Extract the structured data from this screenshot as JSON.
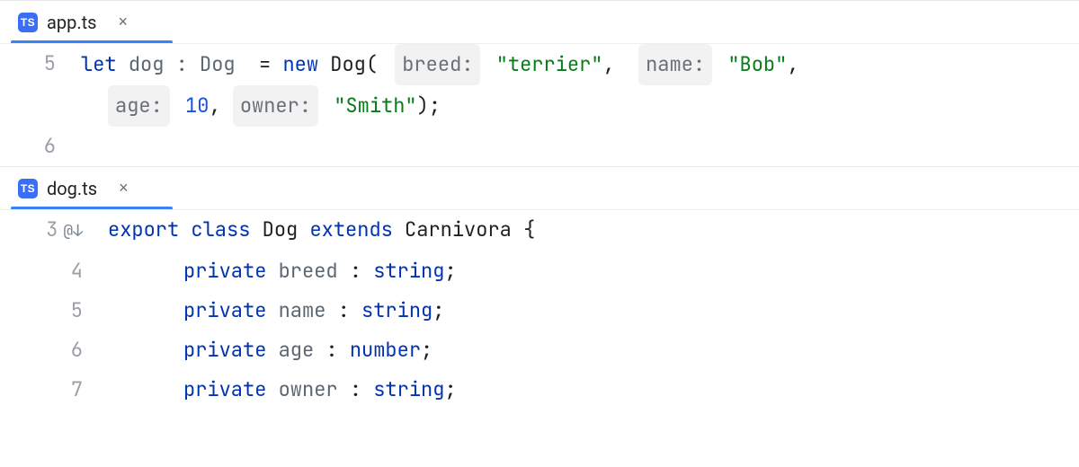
{
  "top": {
    "tab": {
      "icon_label": "TS",
      "filename": "app.ts"
    },
    "lines": [
      "5",
      "6"
    ],
    "code": {
      "let": "let",
      "varname": "dog",
      "colon": ":",
      "typehint": "Dog",
      "eq": "=",
      "new": "new",
      "classname": "Dog",
      "open": "(",
      "h_breed": "breed:",
      "v_breed": "\"terrier\"",
      "comma": ",",
      "h_name": "name:",
      "v_name": "\"Bob\"",
      "h_age": "age:",
      "v_age": "10",
      "h_owner": "owner:",
      "v_owner": "\"Smith\"",
      "close": ");"
    }
  },
  "bottom": {
    "tab": {
      "icon_label": "TS",
      "filename": "dog.ts"
    },
    "gutter_icon": "@↓",
    "lines": [
      "3",
      "4",
      "5",
      "6",
      "7"
    ],
    "code": {
      "export": "export",
      "class": "class",
      "classname": "Dog",
      "extends": "extends",
      "parent": "Carnivora",
      "brace": "{",
      "private": "private",
      "f_breed": "breed",
      "f_name": "name",
      "f_age": "age",
      "f_owner": "owner",
      "colon": ":",
      "t_string": "string",
      "t_number": "number",
      "semi": ";"
    }
  }
}
